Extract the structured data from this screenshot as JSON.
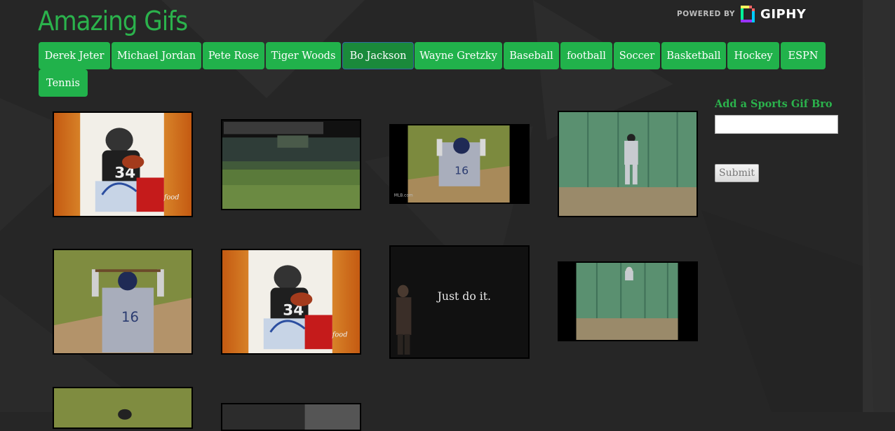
{
  "header": {
    "title": "Amazing Gifs",
    "powered_by": "POWERED BY",
    "brand": "GIPHY"
  },
  "nav": {
    "items": [
      {
        "label": "Derek Jeter"
      },
      {
        "label": "Michael Jordan"
      },
      {
        "label": "Pete Rose"
      },
      {
        "label": "Tiger Woods"
      },
      {
        "label": "Bo Jackson",
        "active": true
      },
      {
        "label": "Wayne Gretzky"
      },
      {
        "label": "Baseball"
      },
      {
        "label": "football"
      },
      {
        "label": "Soccer"
      },
      {
        "label": "Basketball"
      },
      {
        "label": "Hockey"
      },
      {
        "label": "ESPN"
      },
      {
        "label": "Tennis"
      }
    ]
  },
  "gifs": {
    "items": [
      {
        "kind": "football-card",
        "watermark": "food"
      },
      {
        "kind": "stadium"
      },
      {
        "kind": "batter-back",
        "watermark": "MLB.com",
        "jersey": "16"
      },
      {
        "kind": "outfield-wall"
      },
      {
        "kind": "batter-back",
        "jersey": "16"
      },
      {
        "kind": "football-card",
        "watermark": "food"
      },
      {
        "kind": "just-do-it",
        "caption": "Just do it."
      },
      {
        "kind": "outfield-wall-small"
      },
      {
        "kind": "partial-field"
      },
      {
        "kind": "partial-dark"
      }
    ]
  },
  "form": {
    "title": "Add a Sports Gif Bro",
    "input_value": "",
    "submit_label": "Submit"
  },
  "colors": {
    "accent": "#21b24b",
    "title": "#2bb24c",
    "background": "#262626"
  }
}
